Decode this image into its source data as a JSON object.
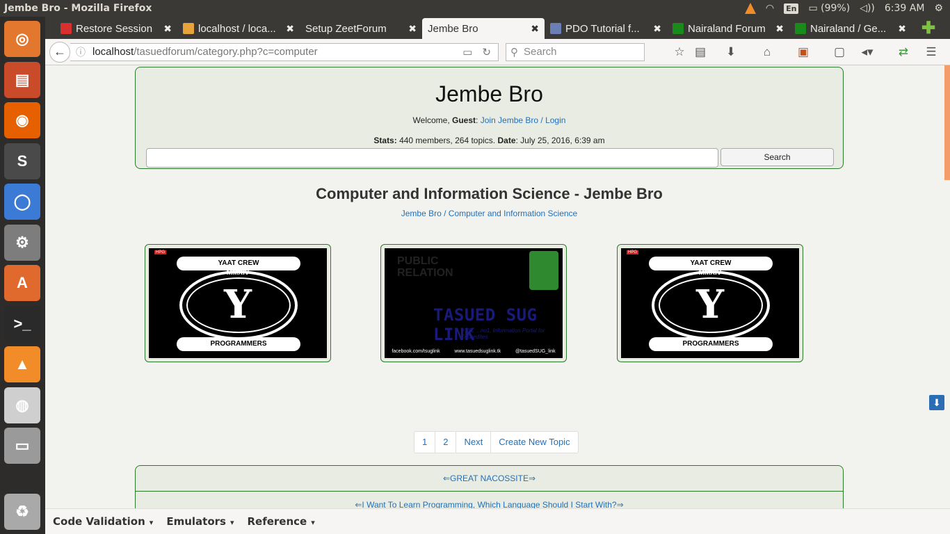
{
  "system_panel": {
    "window_title": "Jembe Bro - Mozilla Firefox",
    "keyboard_lang": "En",
    "battery": "(99%)",
    "clock": "6:39 AM"
  },
  "launcher": {
    "items": [
      {
        "name": "ubuntu-dash",
        "glyph": "◎",
        "color": "#e3772e"
      },
      {
        "name": "files",
        "glyph": "▤",
        "color": "#c94b2a"
      },
      {
        "name": "firefox",
        "glyph": "◉",
        "color": "#e66000"
      },
      {
        "name": "sublime-text",
        "glyph": "S",
        "color": "#4a4a4a"
      },
      {
        "name": "chromium",
        "glyph": "◯",
        "color": "#3b7bd6"
      },
      {
        "name": "system-settings",
        "glyph": "⚙",
        "color": "#7d7d7d"
      },
      {
        "name": "software-center",
        "glyph": "A",
        "color": "#e06a2e"
      },
      {
        "name": "terminal",
        "glyph": ">_",
        "color": "#2a2a2a"
      },
      {
        "name": "vlc",
        "glyph": "▲",
        "color": "#f28c28"
      },
      {
        "name": "speaker-app",
        "glyph": "◍",
        "color": "#cfcfcf"
      },
      {
        "name": "disk",
        "glyph": "▭",
        "color": "#9a9a9a"
      },
      {
        "name": "trash",
        "glyph": "♻",
        "color": "#a9a9a9"
      }
    ]
  },
  "tabs": [
    {
      "label": "Restore Session",
      "favicon_color": "#d92f2f",
      "active": false
    },
    {
      "label": "localhost / loca...",
      "favicon_color": "#e8a33c",
      "active": false
    },
    {
      "label": "Setup ZeetForum",
      "favicon_color": "",
      "active": false
    },
    {
      "label": "Jembe Bro",
      "favicon_color": "",
      "active": true
    },
    {
      "label": "PDO Tutorial f...",
      "favicon_color": "#6a7fb5",
      "active": false
    },
    {
      "label": "Nairaland Forum",
      "favicon_color": "#1a8a1a",
      "active": false
    },
    {
      "label": "Nairaland / Ge...",
      "favicon_color": "#1a8a1a",
      "active": false
    }
  ],
  "tab_close_glyph": "✖",
  "newtab_glyph": "✚",
  "navbar": {
    "url_host": "localhost",
    "url_path": "/tasuedforum/category.php?c=computer",
    "search_placeholder": "Search"
  },
  "page": {
    "site_title": "Jembe Bro",
    "welcome_prefix": "Welcome, ",
    "guest_label": "Guest",
    "welcome_colon": ": ",
    "join_link": "Join Jembe Bro",
    "login_sep": " / ",
    "login_link": "Login",
    "stats_label": "Stats:",
    "stats_text": " 440 members, 264 topics. ",
    "date_label": "Date",
    "date_text": ": July 25, 2016, 6:39 am",
    "search_button": "Search",
    "category_title": "Computer and Information Science - Jembe Bro",
    "breadcrumb_home": "Jembe Bro",
    "breadcrumb_sep": " / ",
    "breadcrumb_category": "Computer and Information Science",
    "images": {
      "crew_top": "YAAT CREW",
      "crew_year": "MMXIV",
      "crew_bottom": "PROGRAMMERS",
      "crew_corner": "HPG",
      "sug_tiles": "PUBLIC RELATION",
      "sug_title": "TASUED SUG LINK",
      "sug_sub": "#TSL ...no1, Information Portal for Tasuedites",
      "sug_fb": "facebook.com/tsuglink",
      "sug_site": "www.tasuedsuglink.tk",
      "sug_tw": "@tasuedSUG_link"
    },
    "pagination": [
      "1",
      "2",
      "Next",
      "Create New Topic"
    ],
    "topics": [
      "⇐GREAT NACOSSITE⇒",
      "⇐I Want To Learn Programming, Which Language Should I Start With?⇒"
    ]
  },
  "bookmarks": [
    "Code Validation",
    "Emulators",
    "Reference"
  ]
}
